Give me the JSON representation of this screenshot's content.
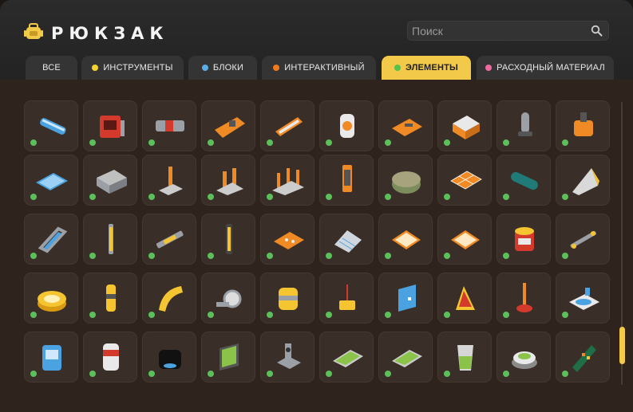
{
  "header": {
    "title": "РЮКЗАК",
    "logo_icon": "backpack-icon",
    "search_placeholder": "Поиск",
    "search_icon": "search-icon"
  },
  "tabs": [
    {
      "label": "ВСЕ",
      "dot": null,
      "active": false
    },
    {
      "label": "ИНСТРУМЕНТЫ",
      "dot": "#f4d22b",
      "active": false
    },
    {
      "label": "БЛОКИ",
      "dot": "#5aaee8",
      "active": false
    },
    {
      "label": "ИНТЕРАКТИВНЫЙ",
      "dot": "#f07a1e",
      "active": false
    },
    {
      "label": "ЭЛЕМЕНТЫ",
      "dot": "#55c24d",
      "active": true
    },
    {
      "label": "РАСХОДНЫЙ МАТЕРИАЛ",
      "dot": "#f06aa2",
      "active": false
    }
  ],
  "colors": {
    "accent": "#f3c94a",
    "status_available": "#5bbf5a"
  },
  "grid": {
    "rows": [
      [
        "pipe-icon",
        "control-panel-icon",
        "bearing-icon",
        "beam-icon",
        "plate-icon",
        "cylinder-icon",
        "tray-icon",
        "box-icon",
        "arm-icon",
        "engine-icon"
      ],
      [
        "floor-plate-icon",
        "container-icon",
        "lever-icon",
        "double-lever-icon",
        "triple-lever-icon",
        "post-icon",
        "round-block-icon",
        "grid-block-icon",
        "tube-icon",
        "wedge-icon"
      ],
      [
        "frame-icon",
        "rod-icon",
        "bar-icon",
        "pole-icon",
        "panel-icon",
        "stairs-icon",
        "tile-icon",
        "tile-icon",
        "bucket-icon",
        "shaft-icon"
      ],
      [
        "disc-icon",
        "column-icon",
        "curve-icon",
        "wheel-mount-icon",
        "barrel-icon",
        "switch-icon",
        "door-icon",
        "sign-icon",
        "plunger-icon",
        "sink-icon"
      ],
      [
        "cabinet-icon",
        "cup-icon",
        "pot-icon",
        "screen-icon",
        "bracket-icon",
        "green-plate-icon",
        "green-plate-icon",
        "glass-icon",
        "button-icon",
        "circuit-icon"
      ]
    ]
  }
}
